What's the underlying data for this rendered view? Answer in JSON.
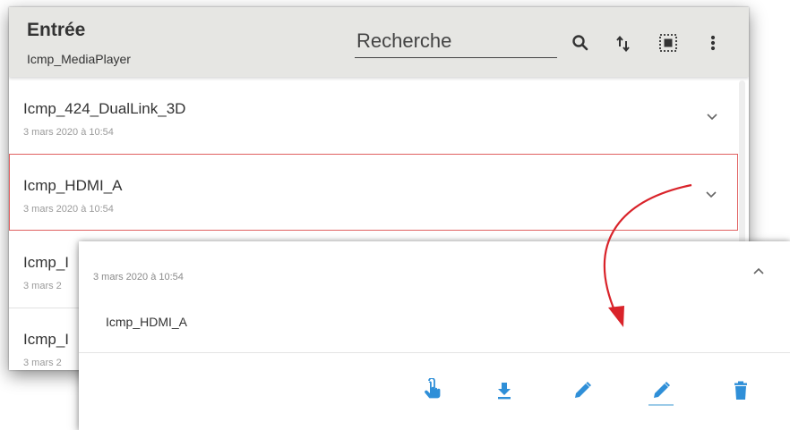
{
  "header": {
    "title": "Entrée",
    "subtitle": "Icmp_MediaPlayer",
    "search_placeholder": "Recherche",
    "icons": [
      "search-icon",
      "sort-icon",
      "select-all-icon",
      "more-vert-icon"
    ]
  },
  "list": {
    "items": [
      {
        "name": "Icmp_424_DualLink_3D",
        "date": "3 mars 2020 à 10:54"
      },
      {
        "name": "Icmp_HDMI_A",
        "date": "3 mars 2020 à 10:54",
        "selected": true
      },
      {
        "name": "Icmp_I",
        "date": "3 mars 2"
      },
      {
        "name": "Icmp_I",
        "date": "3 mars 2"
      }
    ]
  },
  "popup": {
    "date": "3 mars 2020 à 10:54",
    "name": "Icmp_HDMI_A",
    "actions": [
      "touch-icon",
      "download-icon",
      "edit-icon",
      "edit-underlined-icon",
      "delete-icon"
    ]
  },
  "colors": {
    "header_bg": "#e6e6e3",
    "accent_blue": "#2f8fd8",
    "selected_border": "#e06060",
    "arrow_red": "#d9232a"
  }
}
